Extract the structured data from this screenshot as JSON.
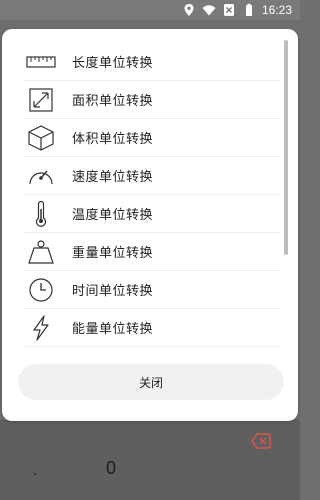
{
  "status_bar": {
    "time": "16:23",
    "icons": [
      "location-icon",
      "wifi-icon",
      "sim-blocked-icon",
      "battery-icon"
    ]
  },
  "dialog": {
    "items": [
      {
        "label": "长度单位转换",
        "icon": "ruler-icon"
      },
      {
        "label": "面积单位转换",
        "icon": "area-icon"
      },
      {
        "label": "体积单位转换",
        "icon": "cube-icon"
      },
      {
        "label": "速度单位转换",
        "icon": "speedometer-icon"
      },
      {
        "label": "温度单位转换",
        "icon": "thermometer-icon"
      },
      {
        "label": "重量单位转换",
        "icon": "weight-icon"
      },
      {
        "label": "时间单位转换",
        "icon": "clock-icon"
      },
      {
        "label": "能量单位转换",
        "icon": "lightning-icon"
      }
    ],
    "close_label": "关闭"
  },
  "background": {
    "keypad_dot": ".",
    "keypad_zero": "0",
    "delete_icon": "backspace-icon",
    "accent_color": "#d9534f"
  }
}
